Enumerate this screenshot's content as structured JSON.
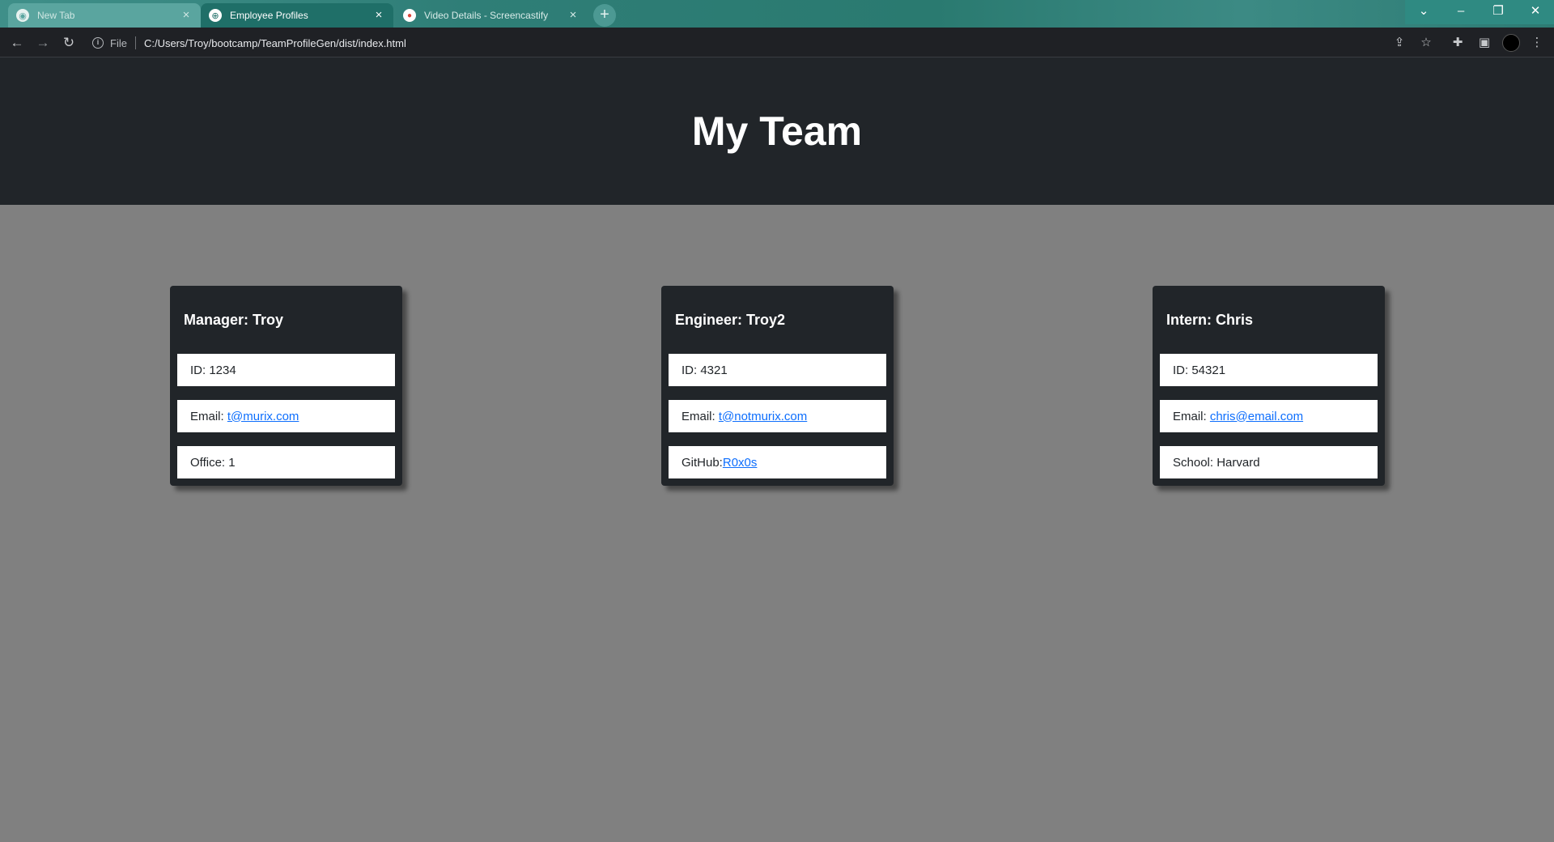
{
  "browser": {
    "tabs": [
      {
        "label": "New Tab",
        "icon": "chrome-icon"
      },
      {
        "label": "Employee Profiles",
        "icon": "globe-icon"
      },
      {
        "label": "Video Details - Screencastify",
        "icon": "screencastify-icon"
      }
    ],
    "address": {
      "scheme": "File",
      "url": "C:/Users/Troy/bootcamp/TeamProfileGen/dist/index.html"
    }
  },
  "page": {
    "title": "My Team",
    "cards": [
      {
        "title": "Manager: Troy",
        "id_text": "ID: 1234",
        "email_prefix": "Email: ",
        "email": "t@murix.com",
        "extra_text": "Office: 1"
      },
      {
        "title": "Engineer: Troy2",
        "id_text": "ID: 4321",
        "email_prefix": "Email: ",
        "email": "t@notmurix.com",
        "extra_prefix": "GitHub:",
        "extra_link": "R0x0s"
      },
      {
        "title": "Intern: Chris",
        "id_text": "ID: 54321",
        "email_prefix": "Email: ",
        "email": "chris@email.com",
        "extra_text": "School: Harvard"
      }
    ]
  },
  "colors": {
    "header_bg": "#212529",
    "page_bg": "#808080",
    "link": "#0d6efd",
    "tabstrip": "#2f7e77"
  }
}
